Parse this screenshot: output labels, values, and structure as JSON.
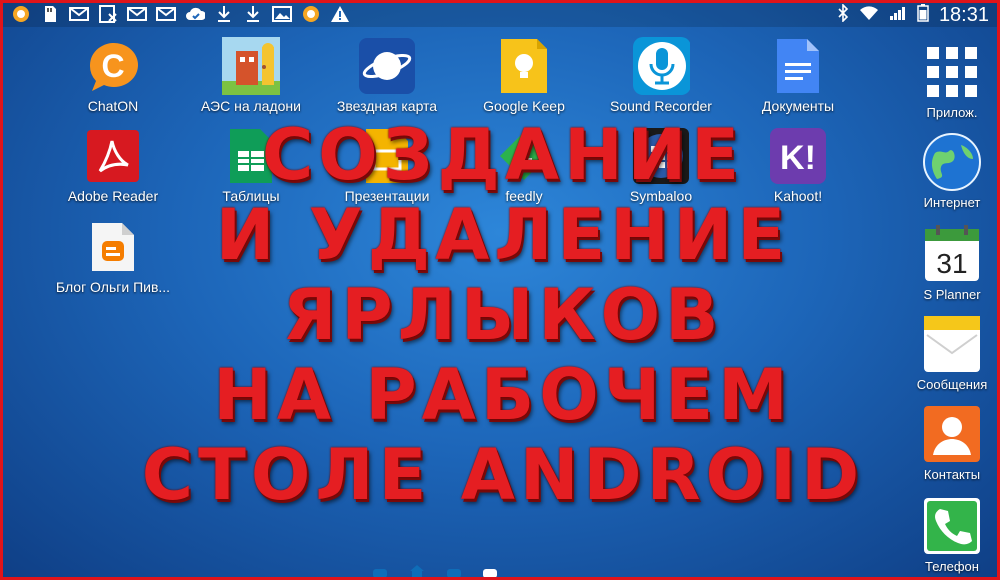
{
  "statusbar": {
    "time": "18:31",
    "left_icons": [
      "notification-orange-icon",
      "sd-card-icon",
      "email-icon",
      "email-blocked-icon",
      "email-icon",
      "email-icon",
      "cloud-sync-icon",
      "download-icon",
      "download-icon",
      "gallery-icon",
      "notification-orange-icon",
      "warning-icon"
    ]
  },
  "apps": [
    {
      "label": "ChatON",
      "icon": "chaton-icon"
    },
    {
      "label": "АЭС на ладони",
      "icon": "aes-app-icon"
    },
    {
      "label": "Звездная карта",
      "icon": "star-map-icon"
    },
    {
      "label": "Google Keep",
      "icon": "google-keep-icon"
    },
    {
      "label": "Sound Recorder",
      "icon": "microphone-icon"
    },
    {
      "label": "Документы",
      "icon": "docs-icon"
    },
    {
      "label": "Adobe Reader",
      "icon": "adobe-reader-icon"
    },
    {
      "label": "Таблицы",
      "icon": "sheets-icon"
    },
    {
      "label": "Презентации",
      "icon": "slides-icon"
    },
    {
      "label": "feedly",
      "icon": "feedly-icon"
    },
    {
      "label": "Symbaloo",
      "icon": "symbaloo-icon"
    },
    {
      "label": "Kahoot!",
      "icon": "kahoot-icon"
    },
    {
      "label": "Блог Ольги Пив...",
      "icon": "blogger-icon"
    }
  ],
  "dock": [
    {
      "label": "Прилож.",
      "icon": "apps-grid-icon"
    },
    {
      "label": "Интернет",
      "icon": "globe-icon"
    },
    {
      "label": "S Planner",
      "icon": "calendar-icon",
      "day": "31"
    },
    {
      "label": "Сообщения",
      "icon": "messages-icon"
    },
    {
      "label": "Контакты",
      "icon": "contacts-icon"
    },
    {
      "label": "Телефон",
      "icon": "phone-icon"
    }
  ],
  "overlay": {
    "lines": [
      "СОЗДАНИЕ",
      "И УДАЛЕНИЕ",
      "ЯРЛЫКОВ",
      "НА РАБОЧЕМ",
      "СТОЛЕ ANDROID"
    ]
  },
  "colors": {
    "border": "#e0141a",
    "overlay_text": "#e51e22",
    "background": "#1d66b9"
  }
}
